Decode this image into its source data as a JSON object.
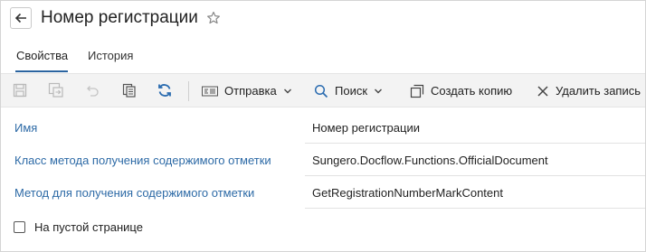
{
  "header": {
    "title": "Номер регистрации",
    "back_icon": "arrow-left-icon",
    "favorite_icon": "star-outline-icon"
  },
  "tabs": [
    {
      "label": "Свойства",
      "active": true
    },
    {
      "label": "История",
      "active": false
    }
  ],
  "toolbar": {
    "icons": [
      "save-icon",
      "save-and-close-icon",
      "undo-icon",
      "copy-pages-icon",
      "refresh-icon"
    ],
    "send": {
      "label": "Отправка",
      "icon": "send-icon"
    },
    "search": {
      "label": "Поиск",
      "icon": "search-icon"
    },
    "copy": {
      "label": "Создать копию",
      "icon": "copy-icon"
    },
    "delete": {
      "label": "Удалить запись",
      "icon": "close-icon"
    }
  },
  "properties": [
    {
      "label": "Имя",
      "value": "Номер регистрации"
    },
    {
      "label": "Класс метода получения содержимого отметки",
      "value": "Sungero.Docflow.Functions.OfficialDocument"
    },
    {
      "label": "Метод для получения содержимого отметки",
      "value": "GetRegistrationNumberMarkContent"
    }
  ],
  "checkbox": {
    "label": "На пустой странице",
    "checked": false
  },
  "colors": {
    "accent": "#2b64a0",
    "label_blue": "#2d6aa6",
    "toolbar_bg": "#f3f3f3",
    "refresh_blue": "#2b6cb0"
  }
}
